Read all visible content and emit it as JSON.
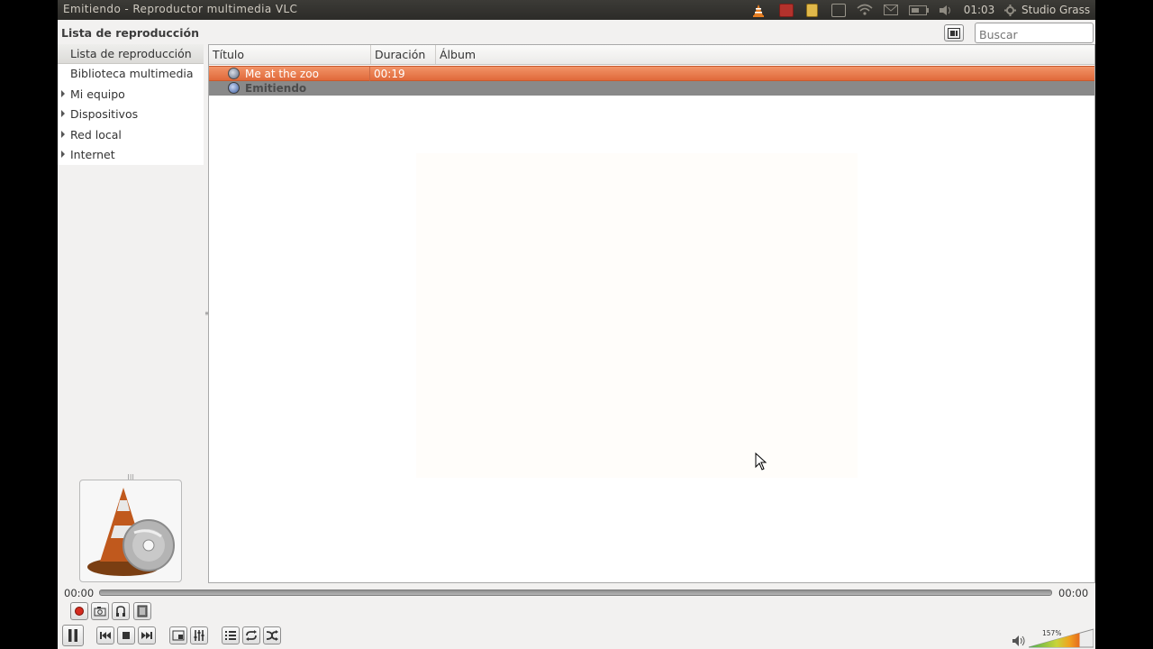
{
  "window": {
    "title": "Emitiendo - Reproductor multimedia VLC"
  },
  "panel": {
    "clock": "01:03",
    "user": "Studio Grass",
    "user_icon": "gear-icon"
  },
  "header": {
    "section_title": "Lista de reproducción",
    "search_placeholder": "Buscar"
  },
  "sidebar": {
    "items": [
      {
        "label": "Lista de reproducción",
        "expandable": false,
        "selected": true
      },
      {
        "label": "Biblioteca multimedia",
        "expandable": false,
        "selected": false
      },
      {
        "label": "Mi equipo",
        "expandable": true,
        "selected": false
      },
      {
        "label": "Dispositivos",
        "expandable": true,
        "selected": false
      },
      {
        "label": "Red local",
        "expandable": true,
        "selected": false
      },
      {
        "label": "Internet",
        "expandable": true,
        "selected": false
      }
    ]
  },
  "playlist": {
    "columns": [
      "Título",
      "Duración",
      "Álbum"
    ],
    "rows": [
      {
        "title": "Me at the zoo",
        "duration": "00:19",
        "album": "",
        "state": "playing",
        "icon": "media-file-icon"
      },
      {
        "title": "Emitiendo",
        "duration": "",
        "album": "",
        "state": "stream",
        "icon": "stream-icon"
      }
    ]
  },
  "seek": {
    "elapsed": "00:00",
    "total": "00:00",
    "progress": 0
  },
  "volume": {
    "label": "157%",
    "level": 1.57
  },
  "colors": {
    "selection": "#e66f3e",
    "panel": "#3c3b37",
    "background": "#f2f1f0",
    "accent_cone": "#c0591d"
  }
}
